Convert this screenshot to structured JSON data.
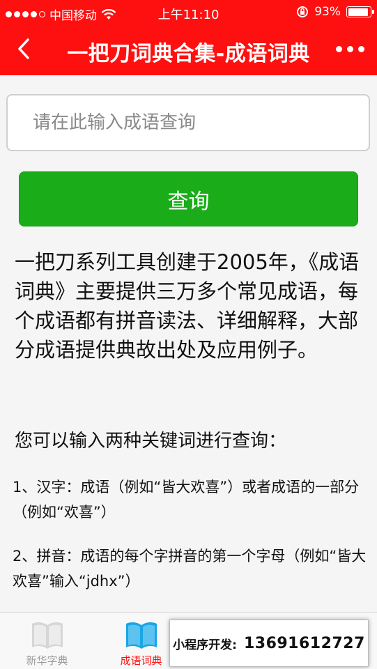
{
  "status_bar": {
    "carrier": "中国移动",
    "time": "上午11:10",
    "battery": "93%",
    "battery_level": 0.93
  },
  "nav": {
    "title": "一把刀词典合集-成语词典"
  },
  "search": {
    "placeholder": "请在此输入成语查询",
    "value": ""
  },
  "query_button": "查询",
  "intro": "一把刀系列工具创建于2005年，《成语词典》主要提供三万多个常见成语，每个成语都有拼音读法、详细解释，大部分成语提供典故出处及应用例子。",
  "subhead": "您可以输入两种关键词进行查询：",
  "tips": [
    "1、汉字：成语（例如“皆大欢喜”）或者成语的一部分（例如“欢喜”）",
    "2、拼音：成语的每个字拼音的第一个字母（例如“皆大欢喜”输入“jdhx”）"
  ],
  "tabs": [
    {
      "label": "新华字典",
      "icon": "book-icon",
      "active": false
    },
    {
      "label": "成语词典",
      "icon": "book-icon",
      "active": true
    },
    {
      "label": "",
      "icon": "book-icon",
      "active": false
    },
    {
      "label": "",
      "icon": "book-icon",
      "active": false
    }
  ],
  "dev_banner": {
    "label": "小程序开发:",
    "phone": "13691612727"
  },
  "colors": {
    "brand_red": "#ff1010",
    "query_green": "#1aad19",
    "tab_active_icon": "#1aa5e6",
    "tab_inactive_icon": "#d6d6d6"
  }
}
